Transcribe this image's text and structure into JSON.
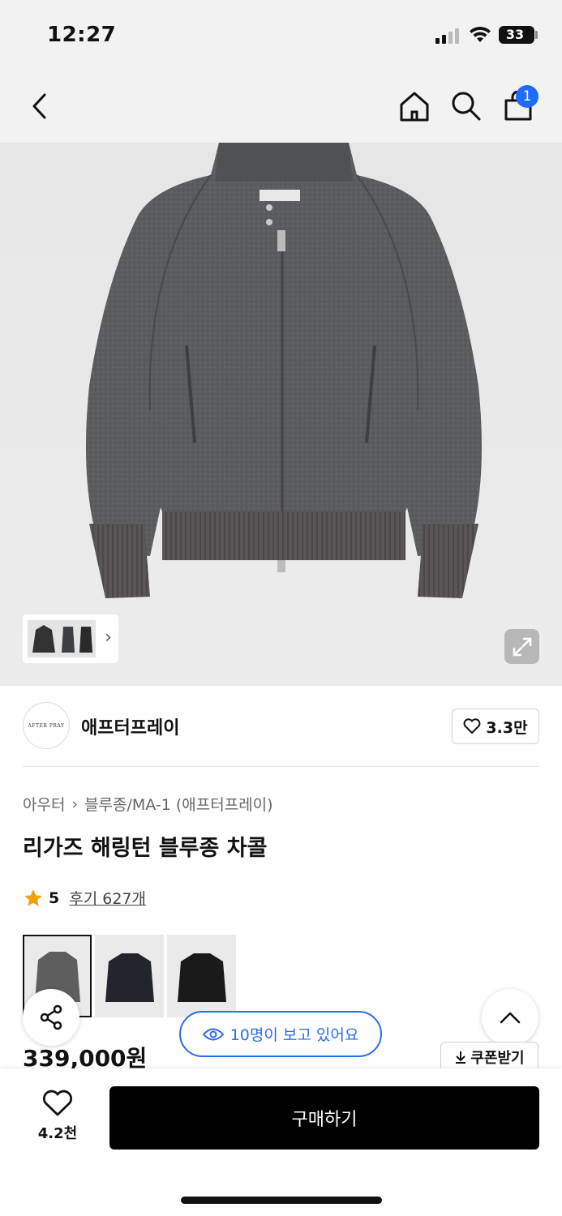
{
  "status": {
    "time": "12:27",
    "battery": "33",
    "battery_fraction": 0.33
  },
  "nav": {
    "back_icon": "chevron-left-icon",
    "home_icon": "home-icon",
    "search_icon": "search-icon",
    "cart_icon": "shopping-bag-icon",
    "cart_count": "1"
  },
  "gallery": {
    "expand_icon": "expand-icon",
    "more_icon": "chevron-right-icon"
  },
  "brand": {
    "logo_text": "AFTER PRAY",
    "name": "애프터프레이",
    "likes": "3.3만"
  },
  "breadcrumb": {
    "category": "아우터",
    "separator": "›",
    "subcategory": "블루종/MA-1 (애프터프레이)"
  },
  "product": {
    "title": "리가즈 해링턴 블루종 차콜",
    "rating_score": "5",
    "review_text": "후기 627개",
    "price": "339,000원"
  },
  "color_options": [
    {
      "name": "charcoal",
      "color": "#5e5e5e"
    },
    {
      "name": "navy",
      "color": "#23252c"
    },
    {
      "name": "black",
      "color": "#1a1a1a"
    }
  ],
  "floating": {
    "share_icon": "share-icon",
    "viewers_text": "10명이 보고 있어요",
    "viewers_icon": "eye-icon",
    "top_icon": "chevron-up-icon",
    "coupon_label": "쿠폰받기"
  },
  "bottom": {
    "wish_count": "4.2천",
    "buy_label": "구매하기"
  },
  "colors": {
    "accent_blue": "#2d6be8",
    "badge_blue": "#1e6bff",
    "buy_black": "#000000",
    "star": "#f59e0b"
  }
}
